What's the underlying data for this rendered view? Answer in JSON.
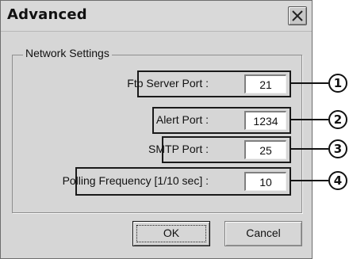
{
  "window": {
    "title": "Advanced"
  },
  "group": {
    "legend": "Network Settings"
  },
  "fields": [
    {
      "label": "Ftp Server Port :",
      "value": "21",
      "callout": "1"
    },
    {
      "label": "Alert Port :",
      "value": "1234",
      "callout": "2"
    },
    {
      "label": "SMTP Port :",
      "value": "25",
      "callout": "3"
    },
    {
      "label": "Polling Frequency [1/10 sec] :",
      "value": "10",
      "callout": "4"
    }
  ],
  "buttons": {
    "ok": "OK",
    "cancel": "Cancel"
  },
  "icons": {
    "close": "close-icon"
  },
  "colors": {
    "dialog_bg": "#d6d6d6",
    "highlight_border": "#1a1a1a"
  }
}
